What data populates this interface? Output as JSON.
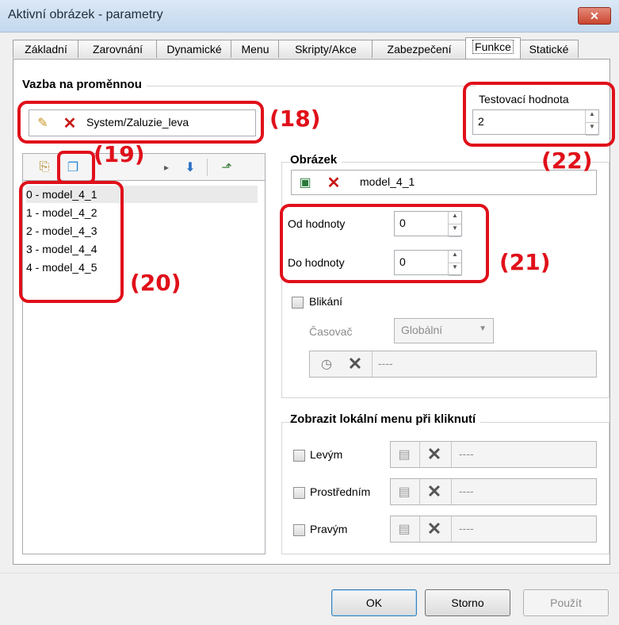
{
  "window": {
    "title": "Aktivní obrázek - parametry",
    "close_glyph": "✕"
  },
  "tabs": [
    {
      "label": "Základní"
    },
    {
      "label": "Zarovnání"
    },
    {
      "label": "Dynamické"
    },
    {
      "label": "Menu"
    },
    {
      "label": "Skripty/Akce"
    },
    {
      "label": "Zabezpečení"
    },
    {
      "label": "Funkce",
      "active": true
    },
    {
      "label": "Statické"
    }
  ],
  "binding": {
    "group_label": "Vazba na proměnnou",
    "variable_value": "System/Zaluzie_leva",
    "test_label": "Testovací hodnota",
    "test_value": "2"
  },
  "list": {
    "items": [
      "0 - model_4_1",
      "1 - model_4_2",
      "2 - model_4_3",
      "3 - model_4_4",
      "4 - model_4_5"
    ],
    "selected_index": 0
  },
  "image_group": {
    "label": "Obrázek",
    "image_value": "model_4_1",
    "from_label": "Od hodnoty",
    "from_value": "0",
    "to_label": "Do hodnoty",
    "to_value": "0",
    "blink_label": "Blikání",
    "timer_label": "Časovač",
    "timer_value": "Globální",
    "timer_field_value": "----"
  },
  "menu_group": {
    "label": "Zobrazit lokální menu při kliknutí",
    "rows": [
      {
        "label": "Levým",
        "value": "----"
      },
      {
        "label": "Prostředním",
        "value": "----"
      },
      {
        "label": "Pravým",
        "value": "----"
      }
    ]
  },
  "buttons": {
    "ok": "OK",
    "cancel": "Storno",
    "apply": "Použít"
  },
  "annotations": {
    "a18": "(18)",
    "a19": "(19)",
    "a20": "(20)",
    "a21": "(21)",
    "a22": "(22)"
  },
  "colors": {
    "annotation_red": "#e0101a",
    "delete_x": "#c81818"
  }
}
